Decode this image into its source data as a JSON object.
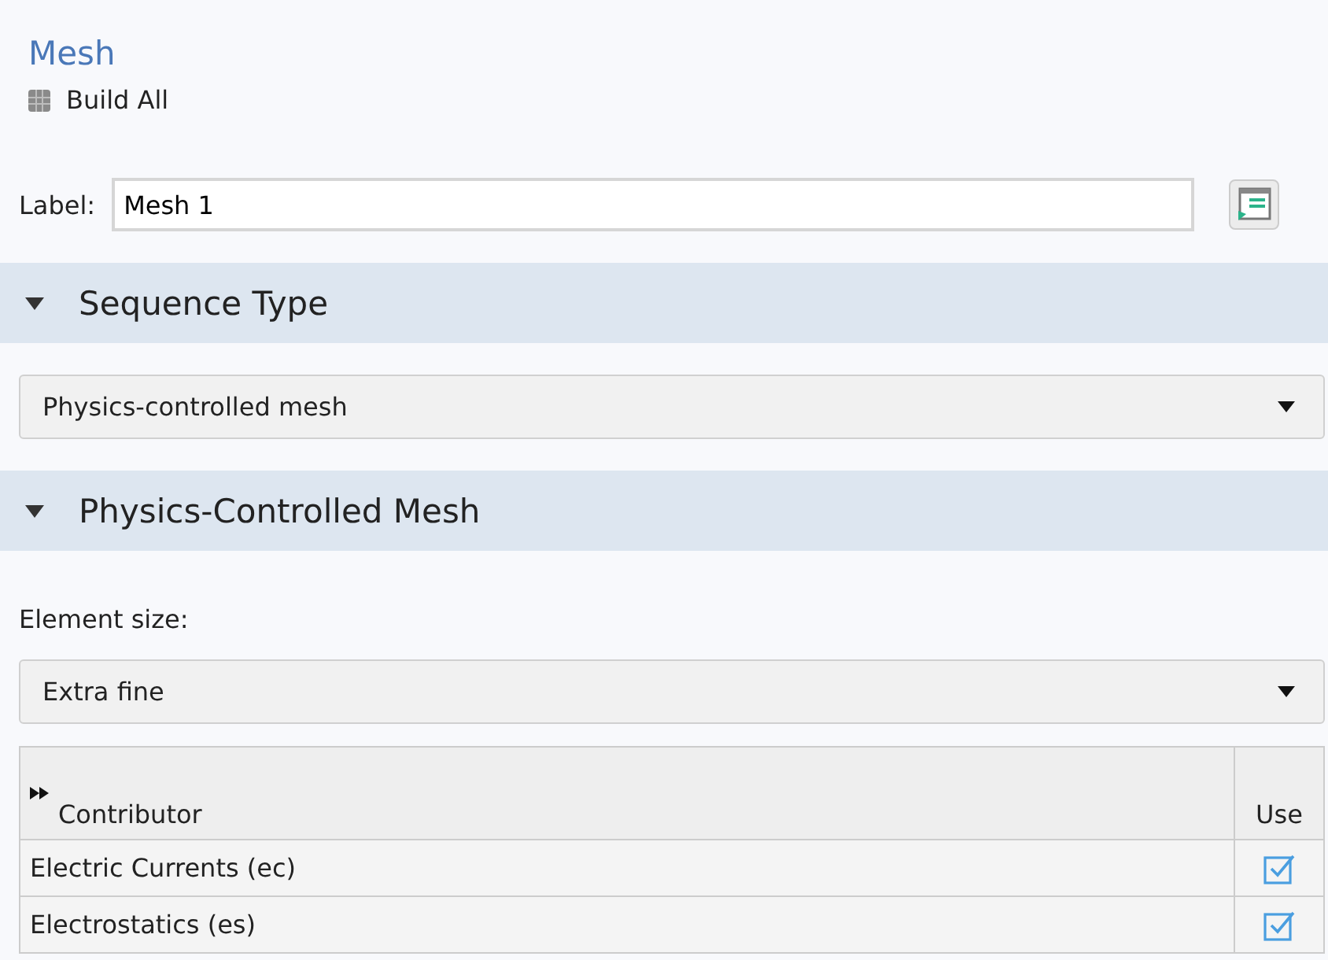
{
  "title": "Mesh",
  "build_button": "Build All",
  "label_field": {
    "label": "Label:",
    "value": "Mesh 1"
  },
  "sections": [
    {
      "title": "Sequence Type",
      "expanded": true,
      "dropdown": "Physics-controlled mesh"
    },
    {
      "title": "Physics-Controlled Mesh",
      "expanded": true,
      "field_label": "Element size:",
      "dropdown": "Extra fine"
    }
  ],
  "table": {
    "columns": [
      "Contributor",
      "Use"
    ],
    "rows": [
      {
        "contributor": "Electric Currents (ec)",
        "use": true
      },
      {
        "contributor": "Electrostatics (es)",
        "use": true
      }
    ]
  }
}
